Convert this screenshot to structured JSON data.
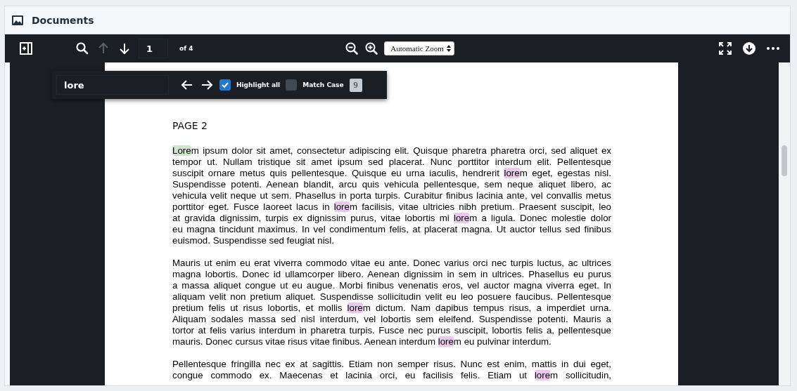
{
  "header": {
    "title": "Documents"
  },
  "toolbar": {
    "page_number": "1",
    "page_count": "of 4",
    "zoom": "Automatic Zoom",
    "previous_disabled": true
  },
  "find_bar": {
    "query": "lore",
    "highlight_all": true,
    "match_case": false,
    "highlight_all_label": "Highlight all",
    "match_case_label": "Match Case",
    "match_count": "9"
  },
  "document": {
    "heading": "PAGE 2",
    "paragraphs": [
      {
        "lines": [
          [
            {
              "text": "Lore",
              "highlighted": true,
              "current": true
            },
            {
              "text": "m ipsum dolor sit amet, consectetur adipiscing elit. Quisque pharetra pharetra orci, sed aliquet ex"
            }
          ],
          [
            {
              "text": "tempor ut. Nullam tristique sit amet ipsum sed placerat. Nunc porttitor interdum elit. Pellentesque"
            }
          ],
          [
            {
              "text": "suscipit ornare metus quis pellentesque. Quisque eu urna iaculis, hendrerit "
            },
            {
              "text": "lore",
              "highlighted": true,
              "current": false
            },
            {
              "text": "m eget, egestas nisl."
            }
          ],
          [
            {
              "text": "Suspendisse potenti. Aenean blandit, arcu quis vehicula pellentesque, sem neque aliquet libero, ac"
            }
          ],
          [
            {
              "text": "vehicula velit neque ut sem. Phasellus in porta turpis. Curabitur finibus lacinia ante, vel convallis metus"
            }
          ],
          [
            {
              "text": "porttitor eget. Fusce laoreet lacus in "
            },
            {
              "text": "lore",
              "highlighted": true,
              "current": false
            },
            {
              "text": "m facilisis, vitae ultricies nibh pretium. Praesent suscipit, leo"
            }
          ],
          [
            {
              "text": "at gravida dignissim, turpis ex dignissim purus, vitae lobortis mi "
            },
            {
              "text": "lore",
              "highlighted": true,
              "current": false
            },
            {
              "text": "m a ligula. Donec molestie dolor"
            }
          ],
          [
            {
              "text": "eu magna tincidunt maximus. In vel condimentum felis, at placerat magna. Ut auctor tellus sed finibus"
            }
          ],
          [
            {
              "text": "euismod. Suspendisse sed feugiat nisl."
            }
          ]
        ],
        "continues": false
      },
      {
        "lines": [
          [
            {
              "text": "Mauris ut enim eu erat viverra commodo vitae eu ante. Donec varius orci nec turpis luctus, ac ultrices"
            }
          ],
          [
            {
              "text": "magna lobortis. Donec id ullamcorper libero. Aenean dignissim in sem in ultrices. Phasellus eu purus"
            }
          ],
          [
            {
              "text": "a massa aliquet congue ut eu augue. Morbi finibus venenatis eros, vel auctor magna viverra eget. In"
            }
          ],
          [
            {
              "text": "aliquam velit non pretium aliquet. Suspendisse sollicitudin velit eu leo posuere faucibus. Pellentesque"
            }
          ],
          [
            {
              "text": "pretium felis ut risus lobortis, et mollis "
            },
            {
              "text": "lore",
              "highlighted": true,
              "current": false
            },
            {
              "text": "m dictum. Nam dapibus tempus risus, a imperdiet urna."
            }
          ],
          [
            {
              "text": "Aliquam sodales massa sed nisl interdum, vel lobortis sem eleifend. Suspendisse potenti. Mauris a"
            }
          ],
          [
            {
              "text": "tortor at felis varius interdum in pharetra turpis. Fusce nec purus suscipit, lobortis felis a, pellentesque"
            }
          ],
          [
            {
              "text": "mauris. Donec cursus vitae risus vitae finibus. Aenean interdum "
            },
            {
              "text": "lore",
              "highlighted": true,
              "current": false
            },
            {
              "text": "m eu pulvinar interdum."
            }
          ]
        ],
        "continues": false
      },
      {
        "lines": [
          [
            {
              "text": "Pellentesque fringilla nec ex at sagittis. Etiam non semper risus. Nunc est enim, mattis in dui eget,"
            }
          ],
          [
            {
              "text": "congue commodo ex. Maecenas et lacinia orci, eu facilisis felis. Etiam ut "
            },
            {
              "text": "lore",
              "highlighted": true,
              "current": false
            },
            {
              "text": "m sollicitudin,"
            }
          ]
        ],
        "continues": true
      }
    ]
  }
}
